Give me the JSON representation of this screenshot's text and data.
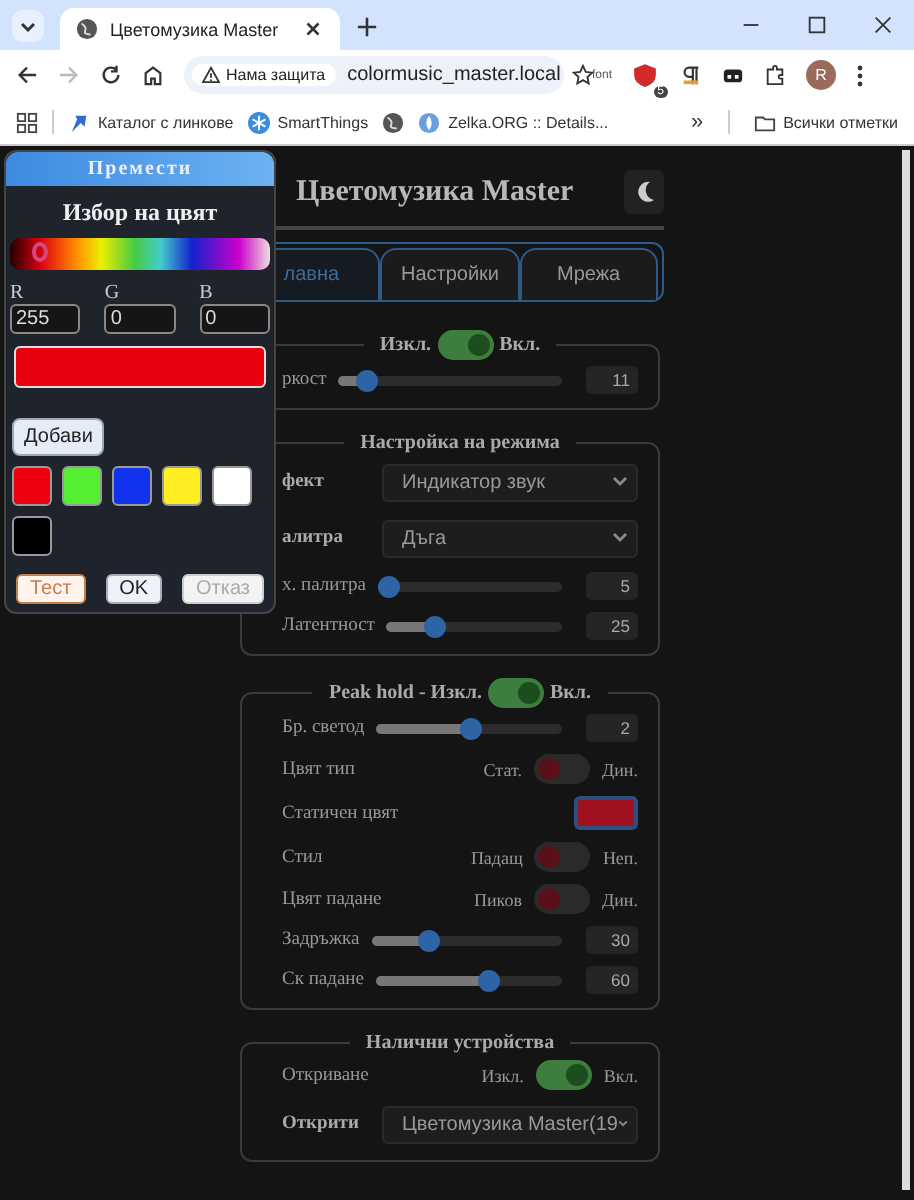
{
  "browser": {
    "tab_title": "Цветомузика Master",
    "security_chip": "Нама защита",
    "url": "colormusic_master.local",
    "extension_label": "font",
    "extension_badge": "5",
    "profile_initial": "R",
    "bookmarks": [
      {
        "kind": "link",
        "label": "Каталог с линкове"
      },
      {
        "kind": "smartthings",
        "label": "SmartThings"
      },
      {
        "kind": "globe"
      },
      {
        "kind": "zelka",
        "label": "Zelka.ORG :: Details..."
      }
    ],
    "overflow": "»",
    "all_bookmarks": "Всички отметки"
  },
  "page": {
    "title": "Цветомузика Master",
    "tabs": [
      {
        "label": "лавна",
        "selected": true
      },
      {
        "label": "Настройки",
        "selected": false
      },
      {
        "label": "Мрежа",
        "selected": false
      }
    ],
    "sections": [
      {
        "legend": [
          {
            "kind": "text",
            "text": "Изкл."
          },
          {
            "kind": "toggle",
            "on": true
          },
          {
            "kind": "text",
            "text": "Вкл."
          }
        ],
        "rows": [
          {
            "kind": "slider",
            "label": "ркост",
            "level": 0.12,
            "value": "11"
          }
        ]
      },
      {
        "legend": [
          {
            "kind": "text",
            "text": "Настройка на режима"
          }
        ],
        "rows": [
          {
            "kind": "select",
            "label": "фект",
            "bold": true,
            "value": "Индикатор звук"
          },
          {
            "kind": "select",
            "label": "алитра",
            "bold": true,
            "value": "Дъга"
          },
          {
            "kind": "slider",
            "label": "х. палитра",
            "level": 0.05,
            "value": "5"
          },
          {
            "kind": "slider",
            "label": "Латентност",
            "level": 0.27,
            "value": "25"
          }
        ]
      },
      {
        "legend": [
          {
            "kind": "text",
            "text": "Peak hold - Изкл."
          },
          {
            "kind": "toggle",
            "on": true
          },
          {
            "kind": "text",
            "text": "Вкл."
          }
        ],
        "rows": [
          {
            "kind": "slider",
            "label": "Бр. светод",
            "level": 0.5,
            "value": "2"
          },
          {
            "kind": "switch",
            "label": "Цвят тип",
            "off_label": "Стат.",
            "on_label": "Дин.",
            "on": false
          },
          {
            "kind": "color",
            "label": "Статичен цвят",
            "color": "#a0101e"
          },
          {
            "kind": "switch",
            "label": "Стил",
            "off_label": "Падащ",
            "on_label": "Неп.",
            "on": false
          },
          {
            "kind": "switch",
            "label": "Цвят падане",
            "off_label": "Пиков",
            "on_label": "Дин.",
            "on": false
          },
          {
            "kind": "slider",
            "label": "Задръжка",
            "level": 0.3,
            "value": "30"
          },
          {
            "kind": "slider",
            "label": "Ск падане",
            "level": 0.6,
            "value": "60"
          }
        ]
      },
      {
        "legend": [
          {
            "kind": "text",
            "text": "Налични устройства"
          }
        ],
        "rows": [
          {
            "kind": "switch",
            "label": "Откриване",
            "off_label": "Изкл.",
            "on_label": "Вкл.",
            "on": true
          },
          {
            "kind": "select",
            "label": "Открити",
            "bold": true,
            "value": "Цветомузика Master(19"
          }
        ]
      }
    ]
  },
  "picker": {
    "handle": "Премести",
    "title": "Избор на цвят",
    "hue": {
      "level": 0.13
    },
    "channels": [
      {
        "label": "R",
        "value": "255"
      },
      {
        "label": "G",
        "value": "0"
      },
      {
        "label": "B",
        "value": "0"
      }
    ],
    "preview": {
      "color": "#e8000f"
    },
    "add_button": "Добави",
    "swatches": [
      {
        "color": "#ee0011"
      },
      {
        "color": "#55ee33"
      },
      {
        "color": "#1133ee"
      },
      {
        "color": "#ffee22"
      },
      {
        "color": "#ffffff"
      },
      {
        "color": "#000000"
      }
    ],
    "buttons": [
      {
        "kind": "test",
        "label": "Тест",
        "disabled": false
      },
      {
        "kind": "ok",
        "label": "OK",
        "disabled": false
      },
      {
        "kind": "cancel",
        "label": "Отказ",
        "disabled": true
      }
    ]
  }
}
